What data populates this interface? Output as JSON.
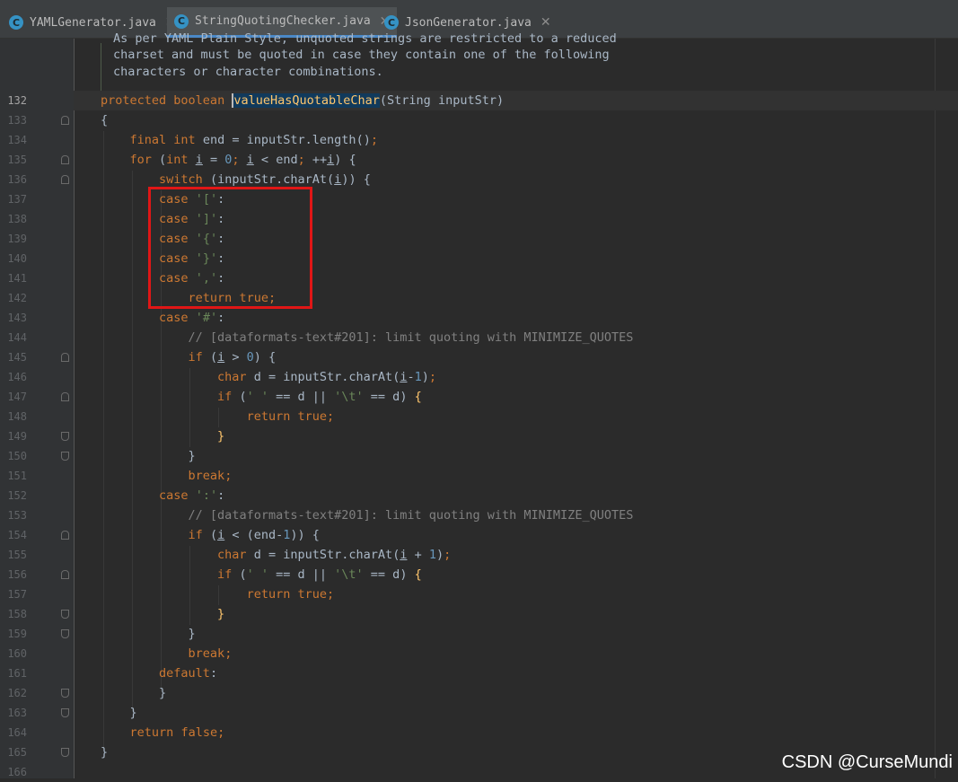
{
  "tabs": [
    {
      "label": "YAMLGenerator.java",
      "icon": "java-class-icon",
      "active": false
    },
    {
      "label": "StringQuotingChecker.java",
      "icon": "java-class-icon",
      "active": true
    },
    {
      "label": "JsonGenerator.java",
      "icon": "java-class-icon",
      "active": false
    }
  ],
  "tab_icon_letter": "C",
  "close_glyph": "✕",
  "doc_comment": [
    "As per YAML Plain Style, unquoted strings are restricted to a reduced",
    "charset and must be quoted in case they contain one of the following",
    "characters or character combinations."
  ],
  "line_numbers": [
    "132",
    "133",
    "134",
    "135",
    "136",
    "137",
    "138",
    "139",
    "140",
    "141",
    "142",
    "143",
    "144",
    "145",
    "146",
    "147",
    "148",
    "149",
    "150",
    "151",
    "152",
    "153",
    "154",
    "155",
    "156",
    "157",
    "158",
    "159",
    "160",
    "161",
    "162",
    "163",
    "164",
    "165",
    "166"
  ],
  "current_line": "132",
  "code": {
    "protected": "protected",
    "boolean": "boolean",
    "method_name": "valueHasQuotableChar",
    "param_type": "String",
    "param_name": "inputStr",
    "final": "final",
    "int": "int",
    "end": "end",
    "inputStr": "inputStr",
    "length": "length",
    "for": "for",
    "i": "i",
    "zero": "0",
    "one": "1",
    "switch": "switch",
    "charAt": "charAt",
    "case": "case",
    "return": "return",
    "true": "true",
    "false": "false",
    "if": "if",
    "char": "char",
    "d": "d",
    "break": "break",
    "default": "default",
    "case_lbracket": "'['",
    "case_rbracket": "']'",
    "case_lbrace": "'{'",
    "case_rbrace": "'}'",
    "case_comma": "','",
    "case_hash": "'#'",
    "case_colon": "':'",
    "space_char": "' '",
    "tab_char": "'\\t'",
    "comment": "// [dataformats-text#201]: limit quoting with MINIMIZE_QUOTES"
  },
  "watermark": "CSDN @CurseMundi",
  "colors": {
    "background": "#2b2b2b",
    "keyword": "#cc7832",
    "string": "#6a8759",
    "number": "#6897bb",
    "comment": "#808080",
    "doc_comment": "#629755",
    "method": "#ffc66d",
    "highlight_box": "#e01616",
    "tab_active_underline": "#4a88c7"
  }
}
